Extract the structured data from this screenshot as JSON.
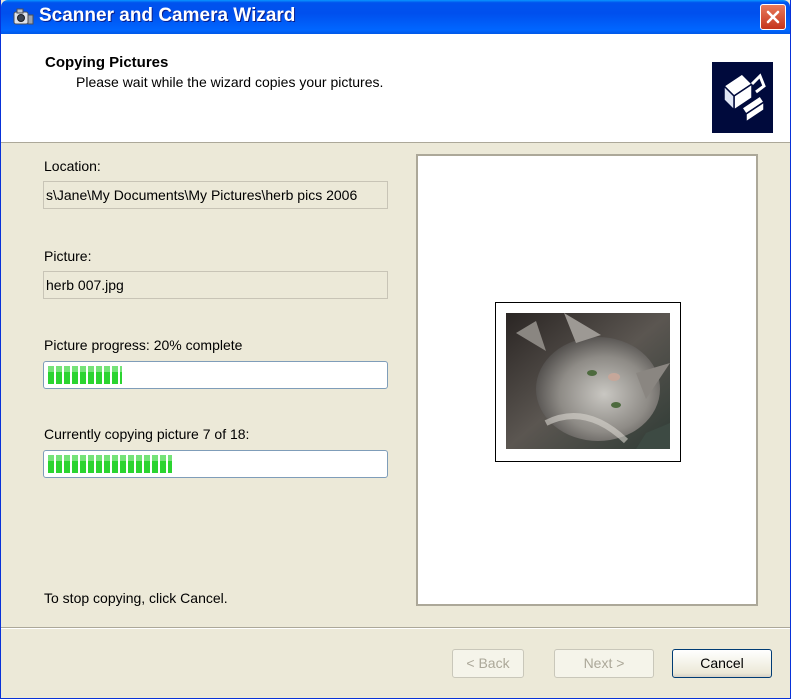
{
  "window": {
    "title": "Scanner and Camera Wizard"
  },
  "header": {
    "title": "Copying Pictures",
    "subtitle": "Please wait while the wizard copies your pictures."
  },
  "location": {
    "label": "Location:",
    "value": "s\\Jane\\My Documents\\My Pictures\\herb pics 2006"
  },
  "picture": {
    "label": "Picture:",
    "value": "herb 007.jpg"
  },
  "picture_progress": {
    "label": "Picture progress: 20% complete",
    "fraction": 0.22
  },
  "overall_progress": {
    "label": "Currently copying picture 7 of 18:",
    "fraction": 0.37
  },
  "footer_note": "To stop copying, click Cancel.",
  "buttons": {
    "back": "< Back",
    "next": "Next >",
    "cancel": "Cancel"
  },
  "colors": {
    "titlebar": "#0053ee",
    "progress_fill": "#2bd430",
    "dialog_bg": "#ece9d8"
  },
  "icons": {
    "title": "scanner-camera-icon",
    "close": "close-icon",
    "header": "wizard-logo-icon"
  }
}
